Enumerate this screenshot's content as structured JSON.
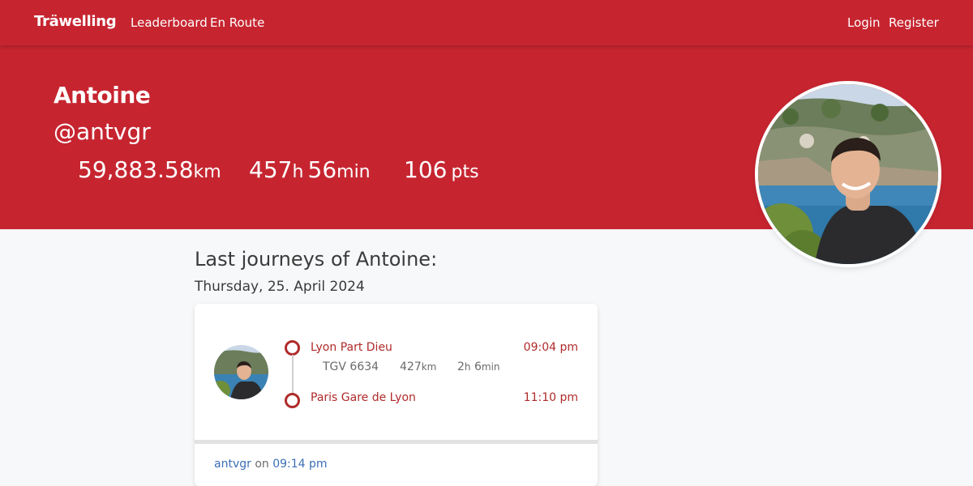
{
  "nav": {
    "brand": "Träwelling",
    "links": [
      "Leaderboard",
      "En Route"
    ],
    "login": "Login",
    "register": "Register"
  },
  "profile": {
    "name": "Antoine",
    "handle": "@antvgr",
    "distance": {
      "value": "59,883.58",
      "unit": "km"
    },
    "duration": {
      "hours": "457",
      "h_unit": "h",
      "minutes": "56",
      "min_unit": "min"
    },
    "points": {
      "value": "106",
      "unit": "pts"
    }
  },
  "journeys": {
    "title": "Last journeys of Antoine:",
    "date": "Thursday, 25. April 2024",
    "items": [
      {
        "origin": "Lyon Part Dieu",
        "departure": "09:04 pm",
        "train": "TGV 6634",
        "distance_value": "427",
        "distance_unit": "km",
        "duration_h": "2",
        "duration_h_unit": "h",
        "duration_min": "6",
        "duration_min_unit": "min",
        "destination": "Paris Gare de Lyon",
        "arrival": "11:10 pm",
        "user": "antvgr",
        "on_text": "on",
        "posted_at": "09:14 pm"
      }
    ]
  },
  "colors": {
    "brand": "#c62530",
    "accent": "#b02a2a",
    "link": "#3b6fb6"
  }
}
